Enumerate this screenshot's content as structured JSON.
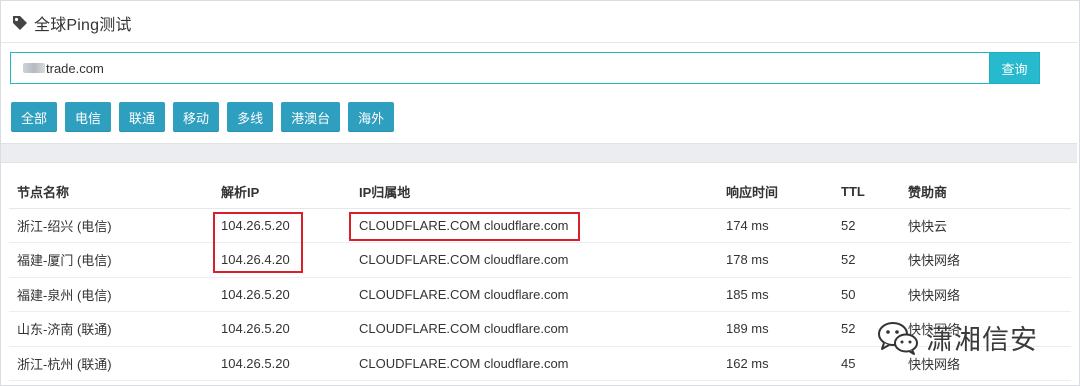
{
  "header": {
    "title": "全球Ping测试"
  },
  "search": {
    "value": "trade.com",
    "button": "查询"
  },
  "filters": [
    "全部",
    "电信",
    "联通",
    "移动",
    "多线",
    "港澳台",
    "海外"
  ],
  "table": {
    "headers": [
      "节点名称",
      "解析IP",
      "IP归属地",
      "响应时间",
      "TTL",
      "赞助商"
    ],
    "rows": [
      [
        "浙江-绍兴 (电信)",
        "104.26.5.20",
        "CLOUDFLARE.COM cloudflare.com",
        "174 ms",
        "52",
        "快快云"
      ],
      [
        "福建-厦门 (电信)",
        "104.26.4.20",
        "CLOUDFLARE.COM cloudflare.com",
        "178 ms",
        "52",
        "快快网络"
      ],
      [
        "福建-泉州 (电信)",
        "104.26.5.20",
        "CLOUDFLARE.COM cloudflare.com",
        "185 ms",
        "50",
        "快快网络"
      ],
      [
        "山东-济南 (联通)",
        "104.26.5.20",
        "CLOUDFLARE.COM cloudflare.com",
        "189 ms",
        "52",
        "快快网络"
      ],
      [
        "浙江-杭州 (联通)",
        "104.26.5.20",
        "CLOUDFLARE.COM cloudflare.com",
        "162 ms",
        "45",
        "快快网络"
      ]
    ]
  },
  "watermark": {
    "text": "潇湘信安",
    "icon": "wechat-icon"
  },
  "colors": {
    "accent": "#2f9fc0",
    "highlight": "#d9202a",
    "link": "#2a87c8"
  }
}
